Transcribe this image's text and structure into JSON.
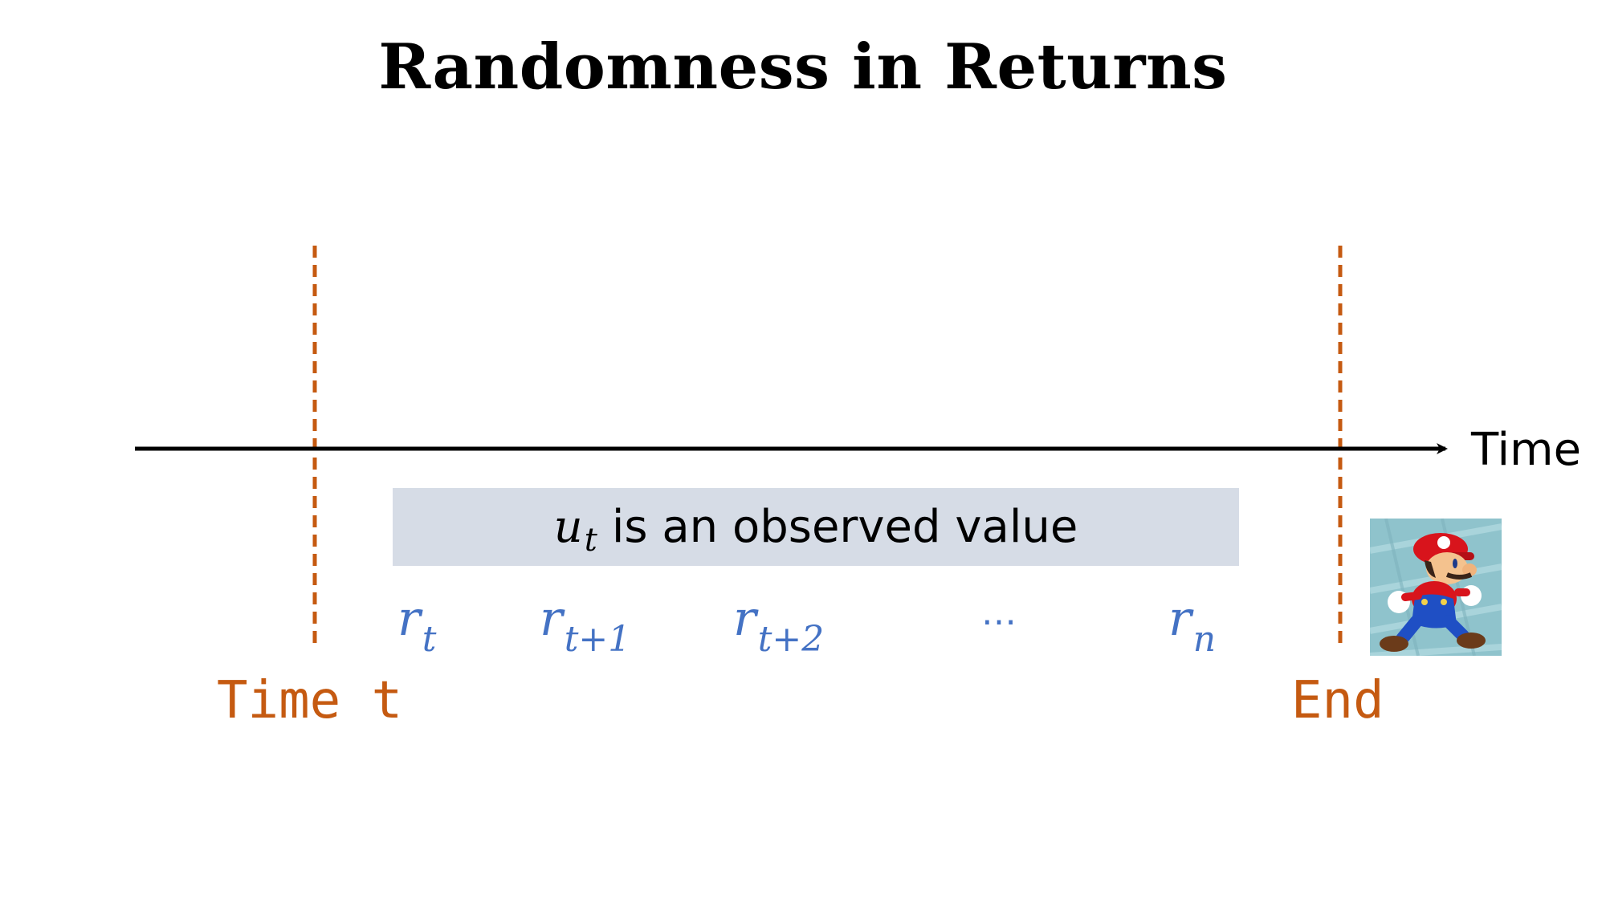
{
  "title": "Randomness in Returns",
  "axis": {
    "label": "Time"
  },
  "markers": {
    "start_label": "Time t",
    "end_label": "End"
  },
  "observation": {
    "symbol": "u",
    "subscript": "t",
    "text": "is an observed value"
  },
  "rewards": [
    {
      "symbol": "r",
      "subscript": "t"
    },
    {
      "symbol": "r",
      "subscript": "t+1"
    },
    {
      "symbol": "r",
      "subscript": "t+2"
    },
    {
      "symbol": "…",
      "subscript": ""
    },
    {
      "symbol": "r",
      "subscript": "n"
    }
  ],
  "colors": {
    "marker_line": "#c55a11",
    "reward_text": "#4472c4",
    "box_fill": "#d6dce6",
    "axis": "#000000"
  },
  "icons": {
    "agent": "mario-character-icon"
  }
}
